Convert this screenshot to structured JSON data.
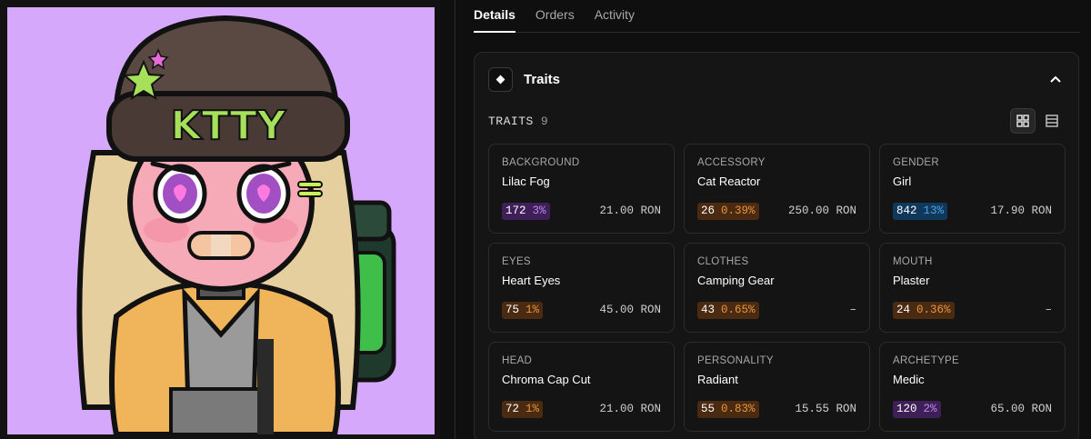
{
  "tabs": [
    {
      "label": "Details"
    },
    {
      "label": "Orders"
    },
    {
      "label": "Activity"
    }
  ],
  "traits": {
    "title": "Traits",
    "count_label": "TRAITS",
    "count": "9",
    "items": [
      {
        "type": "BACKGROUND",
        "value": "Lilac Fog",
        "count": "172",
        "pct": "3%",
        "price": "21.00 RON",
        "tier": "purple"
      },
      {
        "type": "ACCESSORY",
        "value": "Cat Reactor",
        "count": "26",
        "pct": "0.39%",
        "price": "250.00 RON",
        "tier": "orange"
      },
      {
        "type": "GENDER",
        "value": "Girl",
        "count": "842",
        "pct": "13%",
        "price": "17.90 RON",
        "tier": "blue"
      },
      {
        "type": "EYES",
        "value": "Heart Eyes",
        "count": "75",
        "pct": "1%",
        "price": "45.00 RON",
        "tier": "orange"
      },
      {
        "type": "CLOTHES",
        "value": "Camping Gear",
        "count": "43",
        "pct": "0.65%",
        "price": "–",
        "tier": "orange"
      },
      {
        "type": "MOUTH",
        "value": "Plaster",
        "count": "24",
        "pct": "0.36%",
        "price": "–",
        "tier": "orange"
      },
      {
        "type": "HEAD",
        "value": "Chroma Cap Cut",
        "count": "72",
        "pct": "1%",
        "price": "21.00 RON",
        "tier": "orange"
      },
      {
        "type": "PERSONALITY",
        "value": "Radiant",
        "count": "55",
        "pct": "0.83%",
        "price": "15.55 RON",
        "tier": "orange"
      },
      {
        "type": "ARCHETYPE",
        "value": "Medic",
        "count": "120",
        "pct": "2%",
        "price": "65.00 RON",
        "tier": "purple"
      }
    ]
  },
  "artwork": {
    "hat_text": "KTTY",
    "background_color": "#d6a8fb"
  },
  "colors": {
    "purple_bg": "#3e1f57",
    "purple_fg": "#b98be8",
    "orange_bg": "#4a2a10",
    "orange_fg": "#e8953f",
    "blue_bg": "#10385a",
    "blue_fg": "#4aa3e8"
  },
  "icons": {
    "traits": "diamond-icon",
    "collapse": "chevron-up-icon",
    "grid_view": "grid-view-icon",
    "list_view": "list-view-icon"
  }
}
